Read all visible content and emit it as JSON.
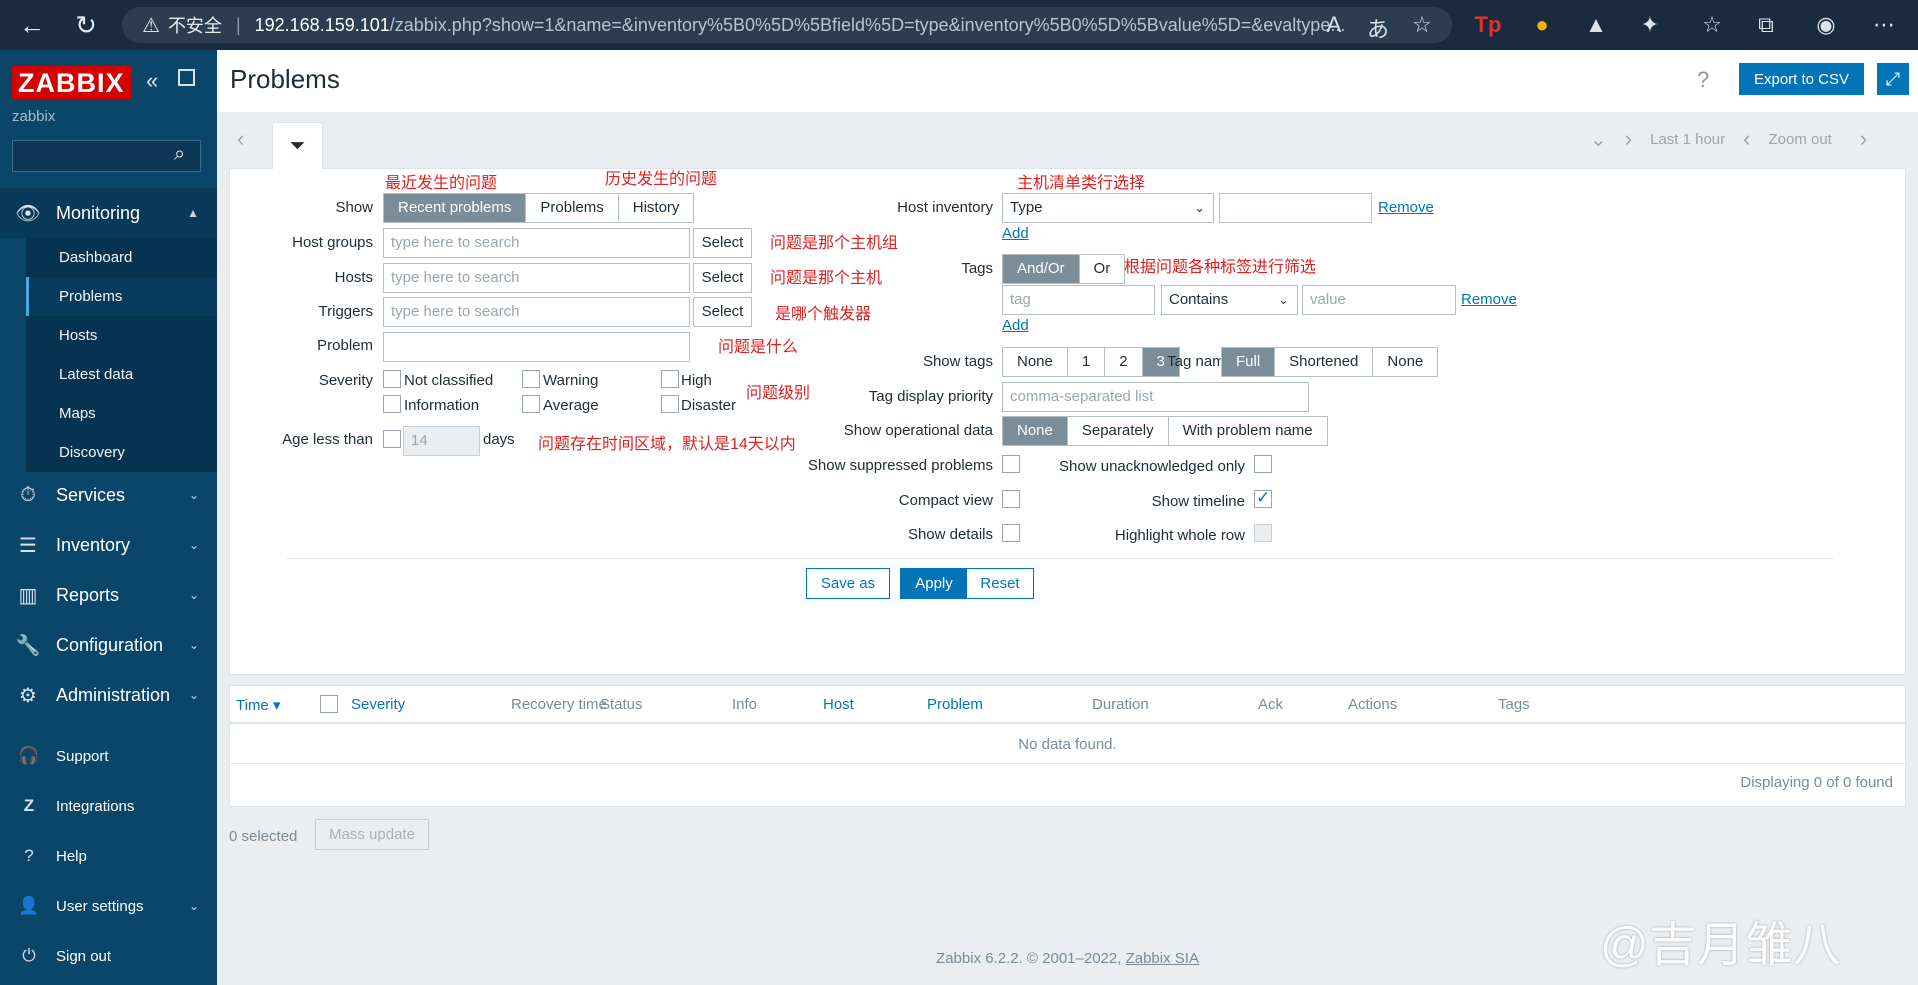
{
  "browser": {
    "security": "不安全",
    "url_host": "192.168.159.101",
    "url_path": "/zabbix.php?show=1&name=&inventory%5B0%5D%5Bfield%5D=type&inventory%5B0%5D%5Bvalue%5D=&evaltype..."
  },
  "sidebar": {
    "logo": "ZABBIX",
    "server_name": "zabbix",
    "monitoring": "Monitoring",
    "monitoring_items": [
      "Dashboard",
      "Problems",
      "Hosts",
      "Latest data",
      "Maps",
      "Discovery"
    ],
    "services": "Services",
    "inventory": "Inventory",
    "reports": "Reports",
    "configuration": "Configuration",
    "administration": "Administration",
    "support": "Support",
    "integrations": "Integrations",
    "help": "Help",
    "user_settings": "User settings",
    "sign_out": "Sign out"
  },
  "header": {
    "title": "Problems",
    "export": "Export to CSV"
  },
  "timebar": {
    "last": "Last 1 hour",
    "zoom": "Zoom out"
  },
  "filter": {
    "show_label": "Show",
    "show_options": [
      "Recent problems",
      "Problems",
      "History"
    ],
    "host_groups_label": "Host groups",
    "hosts_label": "Hosts",
    "triggers_label": "Triggers",
    "problem_label": "Problem",
    "placeholder": "type here to search",
    "select": "Select",
    "severity_label": "Severity",
    "severities": [
      "Not classified",
      "Warning",
      "High",
      "Information",
      "Average",
      "Disaster"
    ],
    "age_label": "Age less than",
    "age_value": "14",
    "age_unit": "days",
    "host_inventory_label": "Host inventory",
    "inventory_type": "Type",
    "remove": "Remove",
    "add": "Add",
    "tags_label": "Tags",
    "tags_eval": [
      "And/Or",
      "Or"
    ],
    "tag_placeholder": "tag",
    "tag_operator": "Contains",
    "value_placeholder": "value",
    "show_tags_label": "Show tags",
    "show_tags_options": [
      "None",
      "1",
      "2",
      "3"
    ],
    "tag_name_label": "Tag name",
    "tag_name_options": [
      "Full",
      "Shortened",
      "None"
    ],
    "tag_priority_label": "Tag display priority",
    "tag_priority_placeholder": "comma-separated list",
    "opdata_label": "Show operational data",
    "opdata_options": [
      "None",
      "Separately",
      "With problem name"
    ],
    "suppressed_label": "Show suppressed problems",
    "unack_label": "Show unacknowledged only",
    "compact_label": "Compact view",
    "timeline_label": "Show timeline",
    "details_label": "Show details",
    "highlight_label": "Highlight whole row",
    "save_as": "Save as",
    "apply": "Apply",
    "reset": "Reset"
  },
  "annotations": {
    "recent": "最近发生的问题",
    "history": "历史发生的问题",
    "host_group": "问题是那个主机组",
    "host": "问题是那个主机",
    "trigger": "是哪个触发器",
    "problem": "问题是什么",
    "severity": "问题级别",
    "age": "问题存在时间区域，默认是14天以内",
    "inventory": "主机清单类行选择",
    "tags": "根据问题各种标签进行筛选"
  },
  "table": {
    "columns": [
      "Time ▾",
      "Severity",
      "Recovery time",
      "Status",
      "Info",
      "Host",
      "Problem",
      "Duration",
      "Ack",
      "Actions",
      "Tags"
    ],
    "empty": "No data found.",
    "paging": "Displaying 0 of 0 found"
  },
  "bottom": {
    "selected": "0 selected",
    "mass_update": "Mass update"
  },
  "footer": {
    "text": "Zabbix 6.2.2. © 2001–2022,",
    "link": "Zabbix SIA"
  },
  "watermark": "@吉月雏八"
}
